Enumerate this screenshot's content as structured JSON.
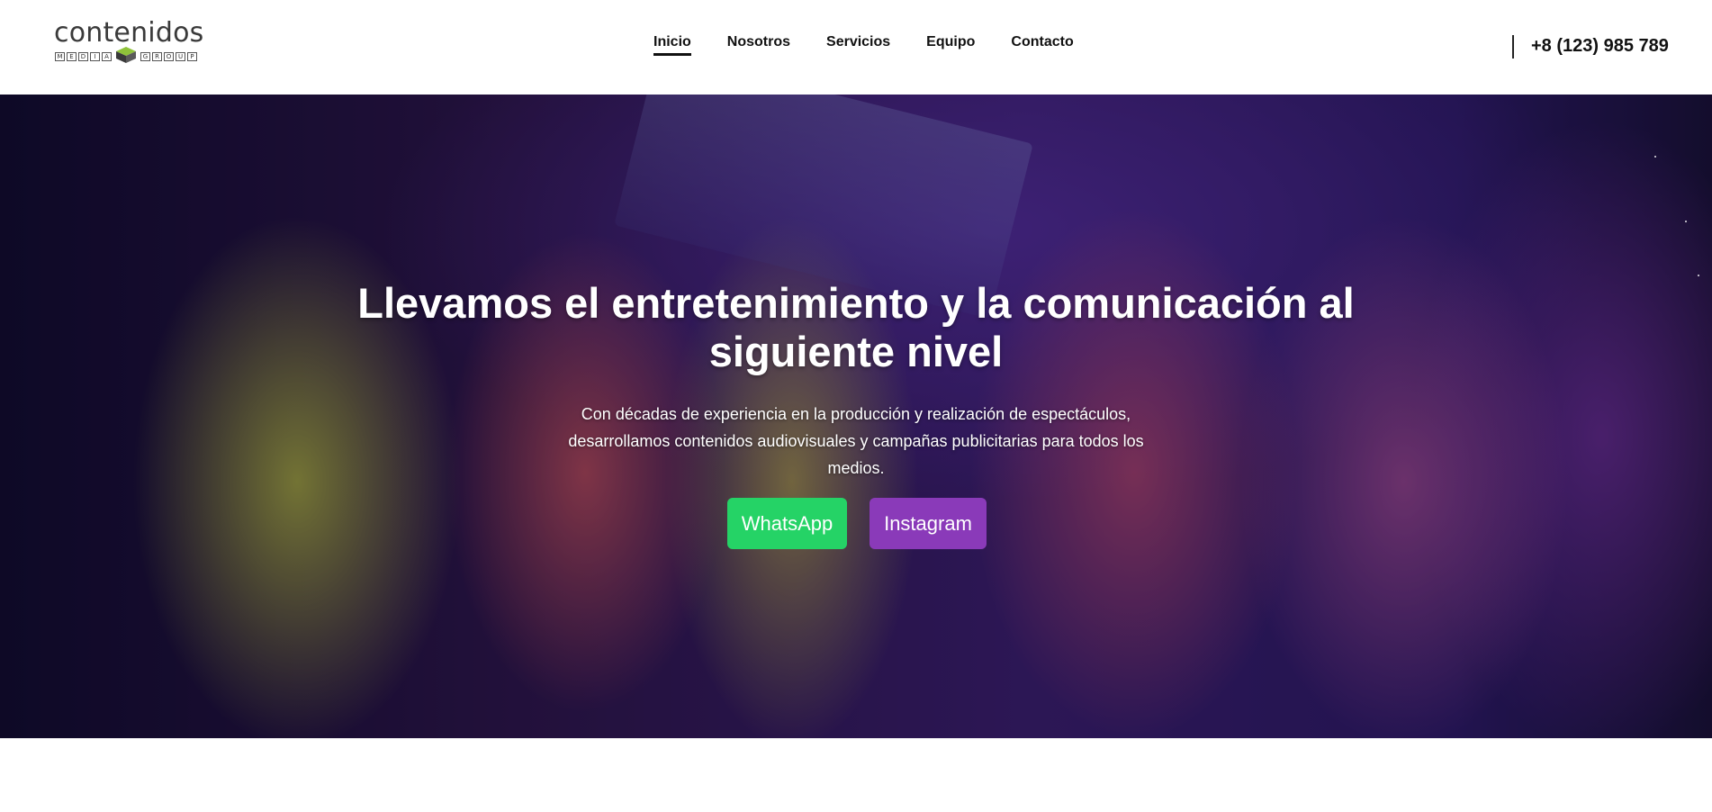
{
  "brand": {
    "name": "contenidos",
    "sub_left": [
      "M",
      "E",
      "D",
      "I",
      "A"
    ],
    "sub_right": [
      "G",
      "R",
      "O",
      "U",
      "P"
    ]
  },
  "nav": {
    "items": [
      {
        "label": "Inicio",
        "active": true
      },
      {
        "label": "Nosotros",
        "active": false
      },
      {
        "label": "Servicios",
        "active": false
      },
      {
        "label": "Equipo",
        "active": false
      },
      {
        "label": "Contacto",
        "active": false
      }
    ]
  },
  "contact": {
    "phone": "+8 (123) 985 789"
  },
  "hero": {
    "title": "Llevamos el entretenimiento y la comunicación al siguiente nivel",
    "text": "Con décadas de experiencia en la producción y realización de espectáculos, desarrollamos contenidos audiovisuales y campañas publicitarias para todos los medios.",
    "buttons": {
      "whatsapp": "WhatsApp",
      "instagram": "Instagram"
    }
  },
  "colors": {
    "whatsapp": "#25d366",
    "instagram": "#8a3ab9",
    "text_dark": "#111111",
    "hero_text": "#ffffff"
  }
}
